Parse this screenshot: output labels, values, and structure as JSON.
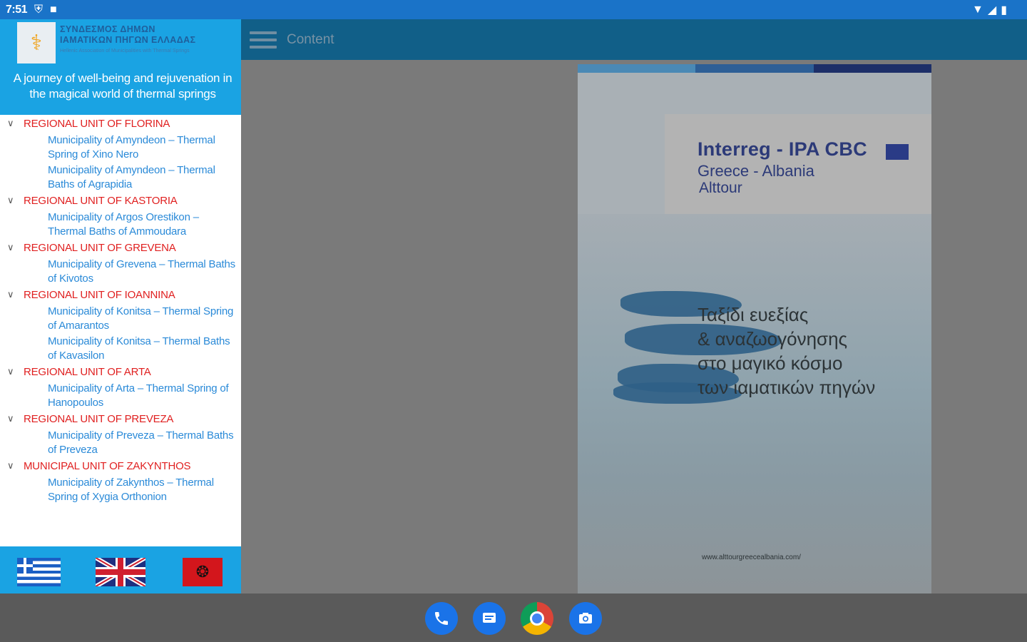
{
  "status_bar": {
    "time": "7:51",
    "shield_icon": "shield-icon",
    "sd_icon": "sd-card-icon"
  },
  "app_bar": {
    "title": "Content",
    "menu_icon": "hamburger-menu-icon"
  },
  "drawer": {
    "org_name_line1": "ΣΥΝΔΕΣΜΟΣ ΔΗΜΩΝ",
    "org_name_line2": "ΙΑΜΑΤΙΚΩΝ ΠΗΓΩΝ ΕΛΛΑΔΑΣ",
    "org_name_line3": "Hellenic Association of Municipalities with Thermal Springs",
    "tagline": "A journey of well-being and rejuvenation in the magical world of thermal springs",
    "groups": [
      {
        "label": "REGIONAL UNIT OF FLORINA",
        "items": [
          "Municipality of Amyndeon – Thermal Spring of Xino Nero",
          "Municipality of Amyndeon – Thermal Baths of Agrapidia"
        ]
      },
      {
        "label": "REGIONAL UNIT OF KASTORIA",
        "items": [
          "Municipality of Argos Orestikon – Thermal Baths of Ammoudara"
        ]
      },
      {
        "label": "REGIONAL UNIT OF GREVENA",
        "items": [
          "Municipality of Grevena – Thermal Baths of Kivotos"
        ]
      },
      {
        "label": "REGIONAL UNIT OF IOANNINA",
        "items": [
          "Municipality of Konitsa – Thermal Spring of Amarantos",
          "Municipality of Konitsa – Thermal Baths of Kavasilon"
        ]
      },
      {
        "label": "REGIONAL UNIT OF ARTA",
        "items": [
          "Municipality of Arta – Thermal Spring of Hanopoulos"
        ]
      },
      {
        "label": "REGIONAL UNIT OF PREVEZA",
        "items": [
          "Municipality of Preveza – Thermal Baths of Preveza"
        ]
      },
      {
        "label": "MUNICIPAL UNIT OF ZAKYNTHOS",
        "items": [
          "Municipality of Zakynthos – Thermal Spring of Xygia Orthonion"
        ]
      }
    ],
    "languages": [
      "greek-flag",
      "uk-flag",
      "albania-flag"
    ]
  },
  "poster": {
    "program": "Interreg - IPA CBC",
    "countries": "Greece - Albania",
    "project": "Alttour",
    "greek_lines": [
      "Ταξίδι ευεξίας",
      "& αναζωογόνησης",
      "στο μαγικό κόσμο",
      "των ιαματικών πηγών"
    ],
    "url": "www.alttourgreecealbania.com/",
    "bar_colors": [
      "#4a89b5",
      "#2d5f96",
      "#1d2f68"
    ]
  },
  "dock": [
    "phone-icon",
    "messages-icon",
    "chrome-icon",
    "camera-icon"
  ]
}
